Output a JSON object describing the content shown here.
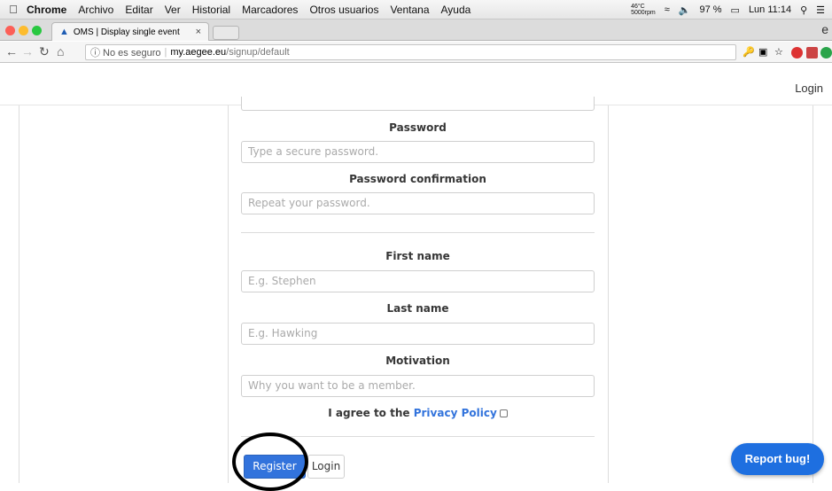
{
  "menubar": {
    "app": "Chrome",
    "items": [
      "Archivo",
      "Editar",
      "Ver",
      "Historial",
      "Marcadores",
      "Otros usuarios",
      "Ventana",
      "Ayuda"
    ],
    "temp_top": "46°C",
    "temp_bottom": "5000rpm",
    "battery": "97 %",
    "clock": "Lun 11:14"
  },
  "tab": {
    "title": "OMS | Display single event",
    "close": "×",
    "right_glyph": "e"
  },
  "address": {
    "security": "ⓘ No es seguro",
    "host": "my.aegee.eu",
    "path": "/signup/default"
  },
  "topnav": {
    "login": "Login"
  },
  "form": {
    "password_placeholder_cut": "",
    "password_label": "Password",
    "password_placeholder": "Type a secure password.",
    "password_confirm_label": "Password confirmation",
    "password_confirm_placeholder": "Repeat your password.",
    "first_name_label": "First name",
    "first_name_placeholder": "E.g. Stephen",
    "last_name_label": "Last name",
    "last_name_placeholder": "E.g. Hawking",
    "motivation_label": "Motivation",
    "motivation_placeholder": "Why you want to be a member.",
    "agree_text": "I agree to the",
    "privacy_link": "Privacy Policy",
    "register_button": "Register",
    "login_button": "Login"
  },
  "report_bug": "Report bug!",
  "colors": {
    "primary": "#3273dc",
    "report": "#1e6fe0"
  }
}
